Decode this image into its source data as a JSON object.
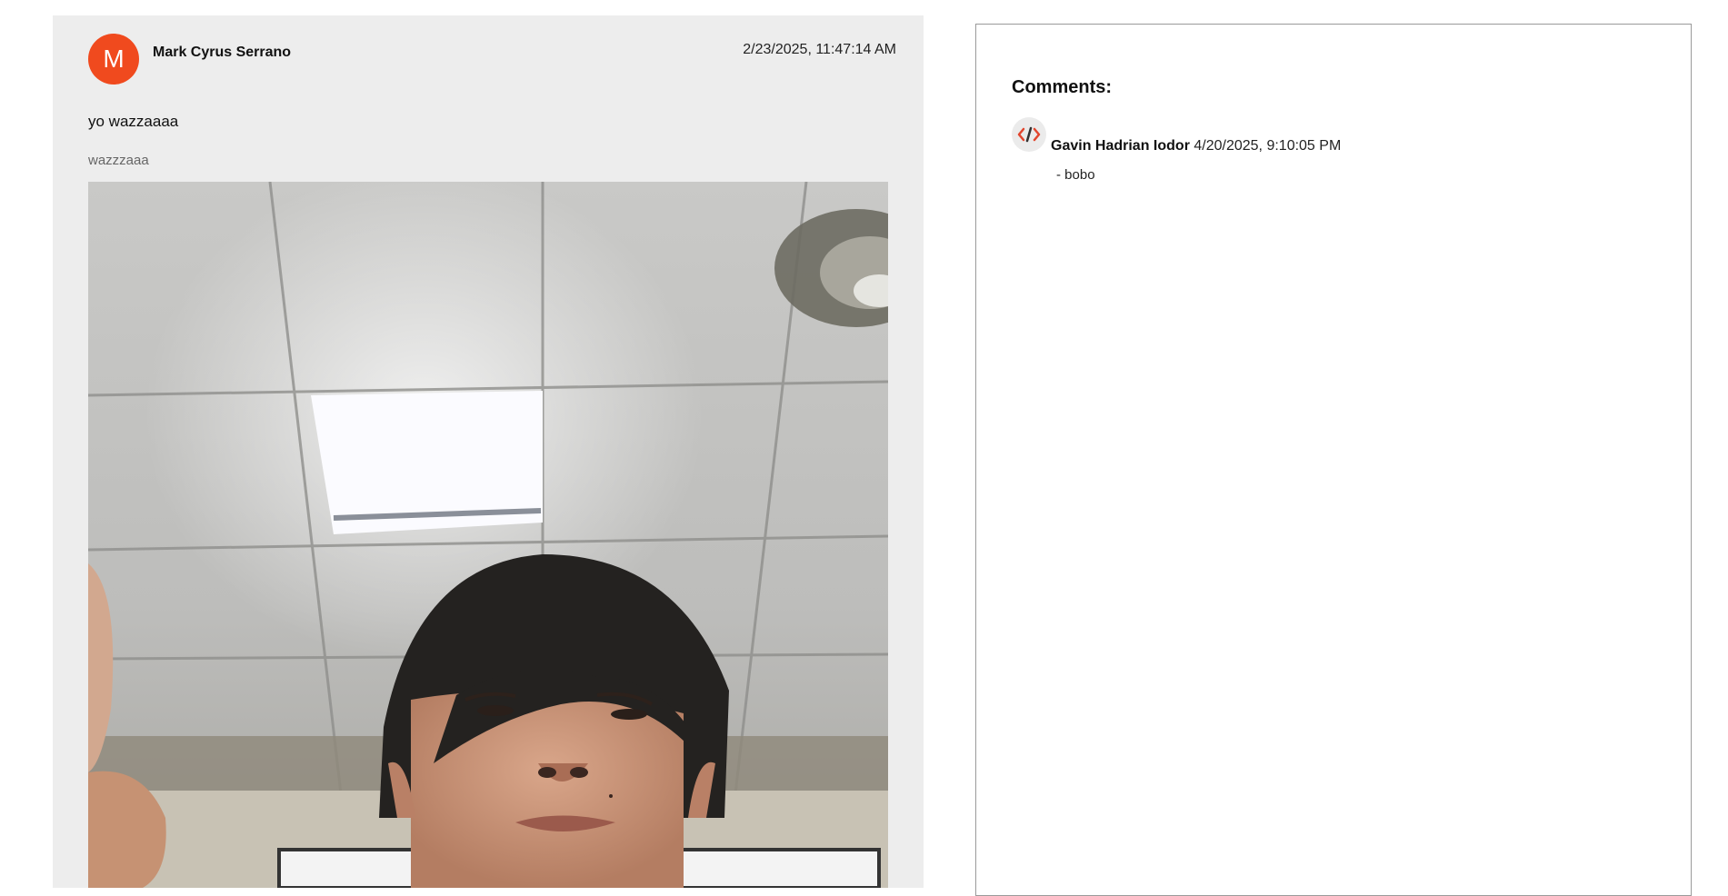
{
  "post": {
    "avatar_letter": "M",
    "author": "Mark Cyrus Serrano",
    "timestamp": "2/23/2025, 11:47:14 AM",
    "title": "yo wazzaaaa",
    "body": "wazzzaaa",
    "image_subject": "selfie photo of a young man under an office ceiling light with a wall fan",
    "avatar_color": "#f04a1e"
  },
  "comments": {
    "heading": "Comments:",
    "items": [
      {
        "avatar_icon": "code-brackets-icon",
        "author": "Gavin Hadrian Iodor",
        "timestamp": "4/20/2025, 9:10:05 PM",
        "text": "- bobo"
      }
    ]
  }
}
